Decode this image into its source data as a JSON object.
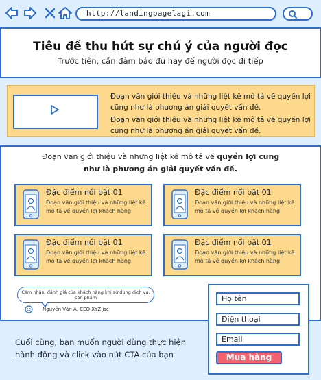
{
  "browser": {
    "url": "http://landingpagelagi.com",
    "accent_color": "#2c6fd0",
    "icons": [
      "back-arrow-icon",
      "forward-arrow-icon",
      "close-icon",
      "home-icon",
      "search-icon"
    ]
  },
  "hero": {
    "title": "Tiêu đề thu hút sự chú ý của người đọc",
    "subtitle": "Trước tiên, cần đảm bảo đủ hay để người đọc đi tiếp"
  },
  "intro": {
    "paragraph_1": "Đoạn văn giới thiệu và những liệt kê mô tả về quyền lợi cũng như là phương án giải quyết vấn đề.",
    "paragraph_2": "Đoạn văn giới thiệu và những liệt kê mô tả về quyền lợi cũng như là phương án giải quyết vấn đề."
  },
  "section": {
    "text_normal": "Đoạn văn giới thiệu và những liệt kê mô tả về ",
    "text_bold": "quyền lợi cũng như là phương án giải quyết vấn đề."
  },
  "features": [
    {
      "title": "Đặc điểm nổi bật 01",
      "description": "Đoạn văn giới thiệu và những liệt kê mô tả về quyền lợi khách hàng"
    },
    {
      "title": "Đặc điểm nổi bật 01",
      "description": "Đoạn văn giới thiệu và những liệt kê mô tả về quyền lợi khách hàng"
    },
    {
      "title": "Đặc điểm nổi bật 01",
      "description": "Đoạn văn giới thiệu và những liệt kê mô tả về quyền lợi khách hàng"
    },
    {
      "title": "Đặc điểm nổi bật 01",
      "description": "Đoạn văn giới thiệu và những liệt kê mô tả về quyền lợi khách hàng"
    }
  ],
  "testimonial": {
    "quote": "Cảm nhận, đánh giá của khách hàng khi sử dụng dịch vụ, sản phẩm",
    "author": "Nguyễn Văn A, CEO XYZ jsc"
  },
  "cta": {
    "text": "Cuối cùng, bạn muốn người dùng thực hiện hành động và click vào nút CTA của bạn"
  },
  "form": {
    "name_label": "Họ tên",
    "phone_label": "Điện thoại",
    "email_label": "Email",
    "button_label": "Mua hàng",
    "button_color": "#f2636f"
  },
  "colors": {
    "highlight_fill": "#fcd98c",
    "band_fill": "#dfeefc"
  }
}
